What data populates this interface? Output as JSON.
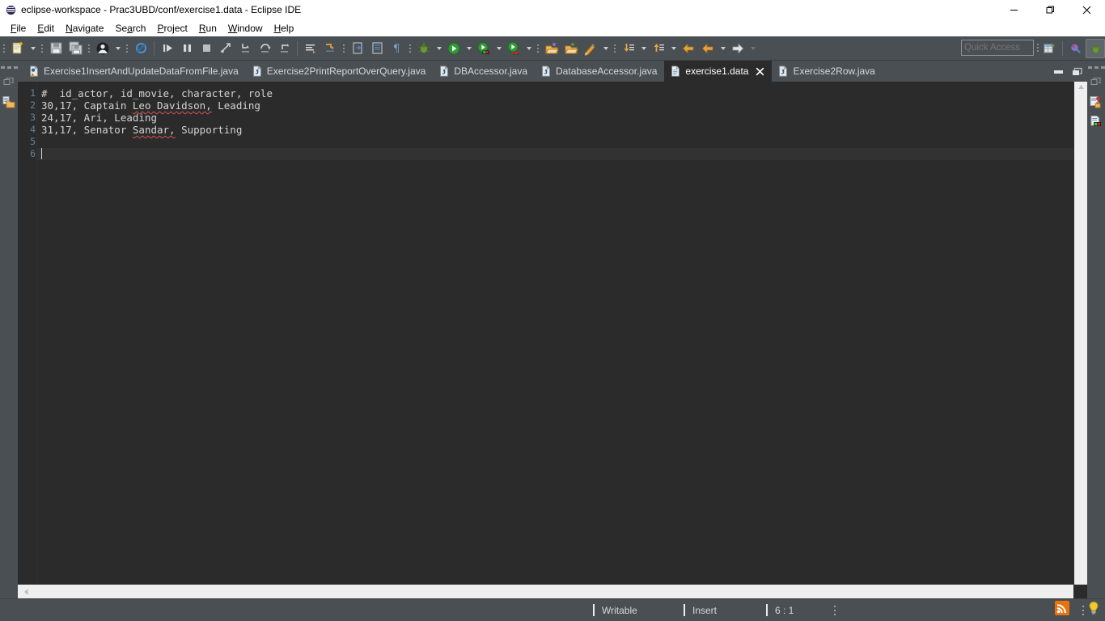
{
  "window": {
    "title": "eclipse-workspace - Prac3UBD/conf/exercise1.data - Eclipse IDE",
    "app_icon": "eclipse-icon",
    "minimize_label": "—",
    "maximize_label": "❐",
    "close_label": "✕"
  },
  "menubar": {
    "items": [
      {
        "label": "File",
        "mnemonic": "F"
      },
      {
        "label": "Edit",
        "mnemonic": "E"
      },
      {
        "label": "Navigate",
        "mnemonic": "N"
      },
      {
        "label": "Search",
        "mnemonic": "a"
      },
      {
        "label": "Project",
        "mnemonic": "P"
      },
      {
        "label": "Run",
        "mnemonic": "R"
      },
      {
        "label": "Window",
        "mnemonic": "W"
      },
      {
        "label": "Help",
        "mnemonic": "H"
      }
    ]
  },
  "toolbar": {
    "quick_access_placeholder": "Quick Access",
    "quick_access_value": "",
    "icons": [
      "new-file-icon",
      "save-icon",
      "save-all-icon",
      "user-profile-icon",
      "skip-breakpoints-icon",
      "resume-icon",
      "suspend-icon",
      "terminate-icon",
      "disconnect-icon",
      "step-into-icon",
      "step-over-icon",
      "step-return-icon",
      "show-whitespace-icon",
      "toggle-mark-occurrences-icon",
      "open-type-icon",
      "open-task-icon",
      "pilcrow-icon",
      "debug-icon",
      "run-icon",
      "coverage-icon",
      "profile-icon",
      "open-perspective-icon",
      "new-java-project-icon",
      "new-java-class-icon",
      "next-annotation-icon",
      "previous-annotation-icon",
      "back-icon",
      "forward-icon"
    ],
    "perspective_icons": [
      "open-perspective-icon",
      "java-perspective-icon",
      "debug-perspective-icon"
    ]
  },
  "editor_tabs": {
    "items": [
      {
        "label": "Exercise1InsertAndUpdateDataFromFile.java",
        "icon": "java-file-warning-icon",
        "active": false,
        "closable": false
      },
      {
        "label": "Exercise2PrintReportOverQuery.java",
        "icon": "java-file-icon",
        "active": false,
        "closable": false
      },
      {
        "label": "DBAccessor.java",
        "icon": "java-file-icon",
        "active": false,
        "closable": false
      },
      {
        "label": "DatabaseAccessor.java",
        "icon": "java-file-icon",
        "active": false,
        "closable": false
      },
      {
        "label": "exercise1.data",
        "icon": "text-file-icon",
        "active": true,
        "closable": true
      },
      {
        "label": "Exercise2Row.java",
        "icon": "java-file-icon",
        "active": false,
        "closable": false
      }
    ],
    "minimize_icon": "minimize-icon",
    "maximize_icon": "maximize-icon"
  },
  "editor": {
    "file_name": "exercise1.data",
    "current_line": 6,
    "lines": [
      {
        "number": "1",
        "text": "#  id_actor, id_movie, character, role",
        "misspelled": []
      },
      {
        "number": "2",
        "text": "30,17, Captain Leo Davidson, Leading",
        "misspelled": [
          "Leo",
          "Davidson,"
        ]
      },
      {
        "number": "3",
        "text": "24,17, Ari, Leading",
        "misspelled": []
      },
      {
        "number": "4",
        "text": "31,17, Senator Sandar, Supporting",
        "misspelled": [
          "Sandar,"
        ]
      },
      {
        "number": "5",
        "text": "",
        "misspelled": []
      },
      {
        "number": "6",
        "text": "",
        "misspelled": []
      }
    ]
  },
  "left_rail": {
    "icons": [
      "restore-icon",
      "package-explorer-icon"
    ]
  },
  "right_rail": {
    "icons": [
      "restore-icon",
      "task-list-icon",
      "outline-icon"
    ]
  },
  "statusbar": {
    "writable": "Writable",
    "insert_mode": "Insert",
    "cursor_position": "6 : 1",
    "right_icons": [
      "rss-feed-icon",
      "tip-of-the-day-icon"
    ]
  },
  "colors": {
    "chrome": "#4a4f53",
    "editor_bg": "#2b2b2b",
    "tab_active_bg": "#2b2b2b",
    "code_text": "#d4d4d4",
    "line_number": "#6a8298",
    "current_line": "#323232",
    "spellcheck": "#d9534f",
    "titlebar_bg": "#ffffff",
    "accent_orange": "#e8730c",
    "run_green": "#36a13a"
  }
}
